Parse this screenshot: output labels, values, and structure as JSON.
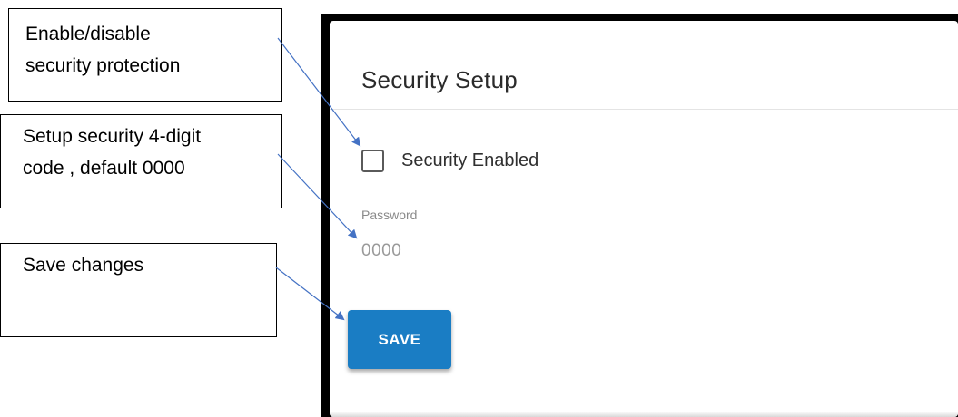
{
  "card": {
    "title": "Security Setup",
    "checkbox_label": "Security Enabled",
    "checkbox_checked": false,
    "password_label": "Password",
    "password_value": "0000",
    "save_label": "SAVE"
  },
  "callouts": {
    "security": [
      "Enable/disable",
      "security protection"
    ],
    "code": [
      "Setup security 4-digit",
      "code , default 0000"
    ],
    "save": [
      "Save changes"
    ]
  },
  "colors": {
    "accent": "#1a7dc4",
    "arrow": "#4472c4",
    "frame": "#000000"
  }
}
